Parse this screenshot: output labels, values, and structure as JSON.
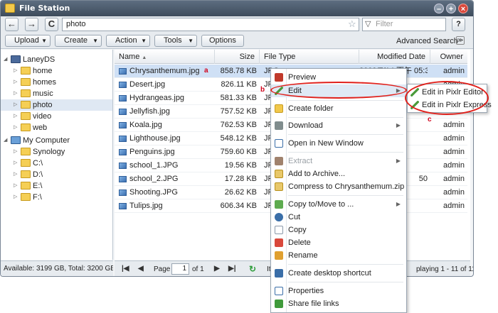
{
  "window": {
    "title": "File Station"
  },
  "nav": {
    "back": "←",
    "forward": "→",
    "refresh": "C",
    "path": "photo",
    "filter_placeholder": "Filter",
    "help": "?"
  },
  "toolbar": {
    "upload": "Upload",
    "create": "Create",
    "action": "Action",
    "tools": "Tools",
    "options": "Options",
    "advanced_search": "Advanced Search"
  },
  "tree": {
    "root1": "LaneyDS",
    "root1_items": [
      "home",
      "homes",
      "music",
      "photo",
      "video",
      "web"
    ],
    "root2": "My Computer",
    "root2_items": [
      "Synology",
      "C:\\",
      "D:\\",
      "E:\\",
      "F:\\"
    ],
    "selected": "photo"
  },
  "status_left": "Available: 3199 GB, Total: 3200 GB",
  "columns": {
    "name": "Name",
    "size": "Size",
    "type": "File Type",
    "date": "Modified Date",
    "owner": "Owner"
  },
  "files": [
    {
      "name": "Chrysanthemum.jpg",
      "size": "858.78 KB",
      "type": "JPG",
      "date": "2009/7/14 下午 05:32",
      "owner": "admin"
    },
    {
      "name": "Desert.jpg",
      "size": "826.11 KB",
      "type": "JPG",
      "date": "",
      "owner": "admin"
    },
    {
      "name": "Hydrangeas.jpg",
      "size": "581.33 KB",
      "type": "JPG",
      "date": "",
      "owner": ""
    },
    {
      "name": "Jellyfish.jpg",
      "size": "757.52 KB",
      "type": "JPG",
      "date": "",
      "owner": ""
    },
    {
      "name": "Koala.jpg",
      "size": "762.53 KB",
      "type": "JPG",
      "date": "",
      "owner": "admin"
    },
    {
      "name": "Lighthouse.jpg",
      "size": "548.12 KB",
      "type": "JPG",
      "date": "",
      "owner": "admin"
    },
    {
      "name": "Penguins.jpg",
      "size": "759.60 KB",
      "type": "JPG",
      "date": "",
      "owner": "admin"
    },
    {
      "name": "school_1.JPG",
      "size": "19.56 KB",
      "type": "JPG",
      "date": "",
      "owner": "admin"
    },
    {
      "name": "school_2.JPG",
      "size": "17.28 KB",
      "type": "JPG",
      "date": "50",
      "owner": "admin"
    },
    {
      "name": "Shooting.JPG",
      "size": "26.62 KB",
      "type": "JPG",
      "date": "",
      "owner": "admin"
    },
    {
      "name": "Tulips.jpg",
      "size": "606.34 KB",
      "type": "JPG",
      "date": "",
      "owner": "admin"
    }
  ],
  "pagination": {
    "page_label": "Page",
    "page_value": "1",
    "of_label": "of 1",
    "items_label": "It",
    "display_text": "playing 1 - 11 of 11",
    "first": "|◀",
    "prev": "◀",
    "next": "▶",
    "last": "▶|",
    "refresh": "↻"
  },
  "context_menu": {
    "preview": "Preview",
    "edit": "Edit",
    "create_folder": "Create folder",
    "download": "Download",
    "open_new_window": "Open in New Window",
    "extract": "Extract",
    "add_archive": "Add to Archive...",
    "compress": "Compress to Chrysanthemum.zip",
    "copy_move": "Copy to/Move to ...",
    "cut": "Cut",
    "copy": "Copy",
    "delete": "Delete",
    "rename": "Rename",
    "desktop_shortcut": "Create desktop shortcut",
    "properties": "Properties",
    "share_links": "Share file links"
  },
  "submenu": {
    "pixlr_editor": "Edit in Pixlr Editor",
    "pixlr_express": "Edit in Pixlr Express"
  },
  "annotations": {
    "a": "a",
    "b": "b",
    "c": "c"
  },
  "colors": {
    "highlight": "#e0201b",
    "selection": "#cfe0f5"
  }
}
